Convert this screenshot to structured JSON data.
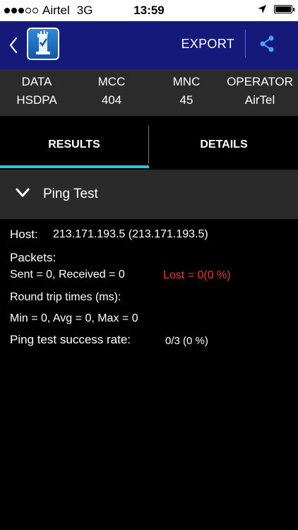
{
  "status_bar": {
    "carrier": "Airtel",
    "network": "3G",
    "time": "13:59",
    "battery_level": 1.0
  },
  "app_bar": {
    "export_label": "EXPORT",
    "icons": {
      "back": "chevron-left-icon",
      "logo": "app-logo-icon",
      "share": "share-icon"
    }
  },
  "info_panel": {
    "columns": [
      {
        "label": "DATA",
        "value": "HSDPA"
      },
      {
        "label": "MCC",
        "value": "404"
      },
      {
        "label": "MNC",
        "value": "45"
      },
      {
        "label": "OPERATOR",
        "value": "AirTel"
      }
    ]
  },
  "tabs": [
    {
      "label": "RESULTS",
      "active": true
    },
    {
      "label": "DETAILS",
      "active": false
    }
  ],
  "section": {
    "title": "Ping Test"
  },
  "results": {
    "host_label": "Host:",
    "host_value": "213.171.193.5 (213.171.193.5)",
    "packets_label": "Packets:",
    "sent_received": "Sent = 0, Received = 0",
    "lost": "Lost = 0(0 %)",
    "rtt_label": "Round trip times (ms):",
    "rtt_values": "Min = 0, Avg = 0, Max = 0",
    "success_label": "Ping test success rate:",
    "success_value": "0/3 (0 %)"
  },
  "colors": {
    "app_bar": "#15197a",
    "tab_indicator": "#28c7d8",
    "lost_text": "#e23a3a"
  }
}
